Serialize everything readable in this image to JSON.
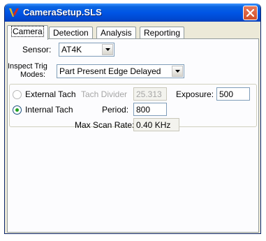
{
  "window": {
    "title": "CameraSetup.SLS"
  },
  "tabs": [
    {
      "label": "Camera",
      "active": true
    },
    {
      "label": "Detection",
      "active": false
    },
    {
      "label": "Analysis",
      "active": false
    },
    {
      "label": "Reporting",
      "active": false
    }
  ],
  "camera": {
    "sensor_label": "Sensor:",
    "sensor_value": "AT4K",
    "trig_label_1": "Inspect Trig",
    "trig_label_2": "Modes:",
    "trig_value": "Part Present Edge Delayed",
    "external_tach_label": "External Tach",
    "tach_divider_label": "Tach Divider",
    "tach_divider_value": "25.313",
    "exposure_label": "Exposure:",
    "exposure_value": "500",
    "internal_tach_label": "Internal Tach",
    "period_label": "Period:",
    "period_value": "800",
    "max_scan_label": "Max Scan Rate:",
    "max_scan_value": "0.40 KHz",
    "tach_mode": "Internal Tach"
  },
  "icons": {
    "app": "v-logo-icon",
    "close": "close-icon",
    "dropdown": "chevron-down-icon"
  }
}
